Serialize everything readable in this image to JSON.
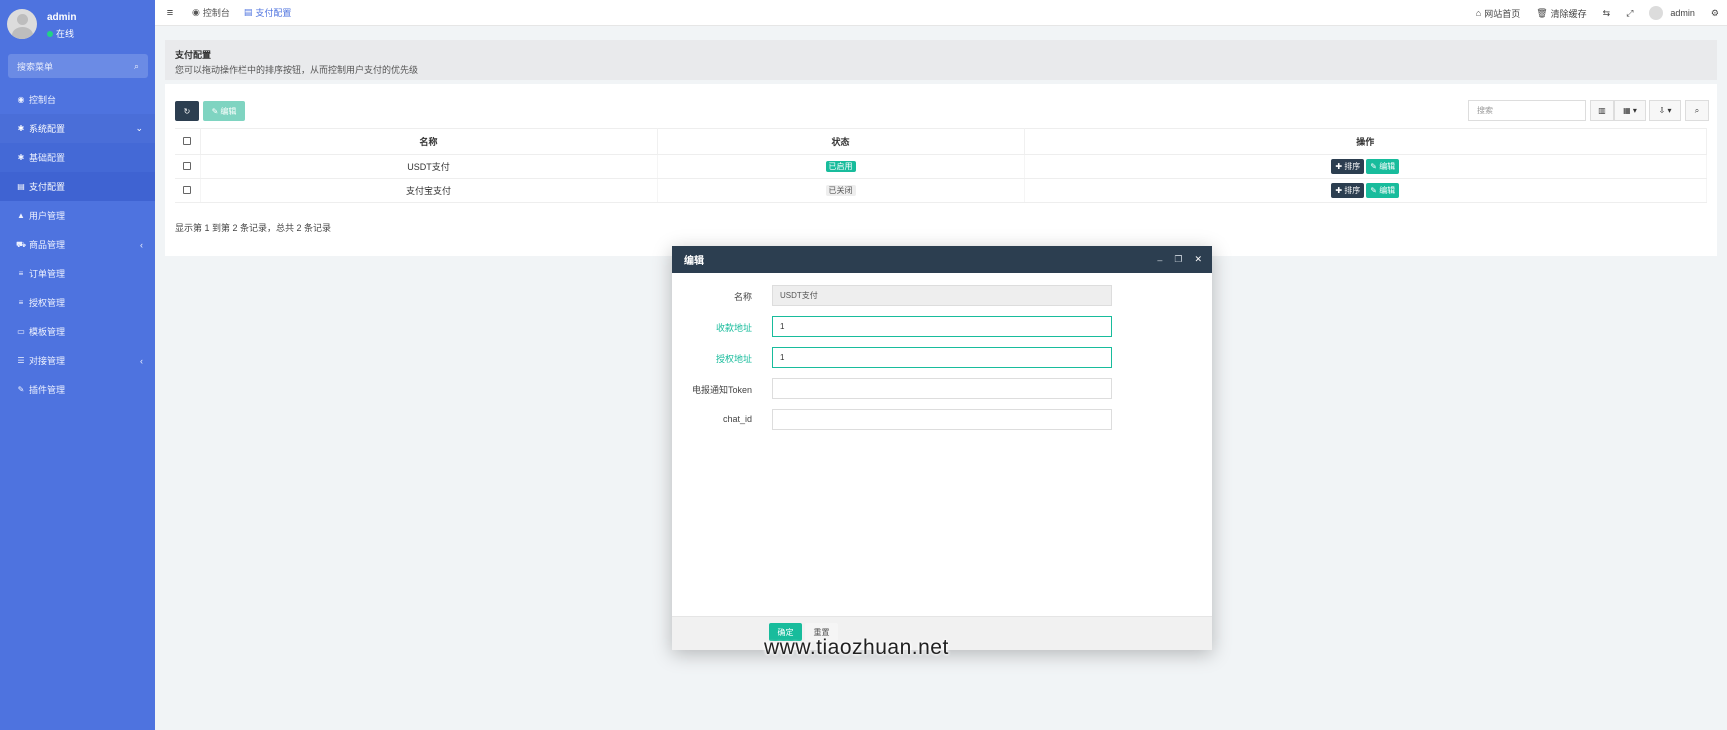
{
  "sidebar": {
    "user": {
      "name": "admin",
      "status": "在线"
    },
    "search_placeholder": "搜索菜单",
    "items": [
      {
        "label": "控制台",
        "icon": "dashboard-icon",
        "glyph": "◉"
      },
      {
        "label": "系统配置",
        "icon": "gear-icon",
        "glyph": "✱",
        "arrow": "⌄"
      },
      {
        "label": "基础配置",
        "icon": "gear-icon",
        "glyph": "✱"
      },
      {
        "label": "支付配置",
        "icon": "table-icon",
        "glyph": "▤"
      },
      {
        "label": "用户管理",
        "icon": "user-icon",
        "glyph": "▲"
      },
      {
        "label": "商品管理",
        "icon": "cart-icon",
        "glyph": "⛟",
        "arrow": "‹"
      },
      {
        "label": "订单管理",
        "icon": "list-icon",
        "glyph": "≡"
      },
      {
        "label": "授权管理",
        "icon": "list-icon",
        "glyph": "≡"
      },
      {
        "label": "模板管理",
        "icon": "template-icon",
        "glyph": "▭"
      },
      {
        "label": "对接管理",
        "icon": "sliders-icon",
        "glyph": "☰",
        "arrow": "‹"
      },
      {
        "label": "插件管理",
        "icon": "plug-icon",
        "glyph": "✎"
      }
    ]
  },
  "topbar": {
    "tabs": [
      {
        "label": "控制台",
        "icon": "dashboard-icon"
      },
      {
        "label": "支付配置",
        "icon": "table-icon"
      }
    ],
    "right": {
      "home": "网站首页",
      "clear_cache": "清除缓存",
      "user": "admin"
    }
  },
  "page": {
    "title": "支付配置",
    "description": "您可以拖动操作栏中的排序按钮，从而控制用户支付的优先级"
  },
  "toolbar": {
    "edit_label": "编辑",
    "search_placeholder": "搜索"
  },
  "table": {
    "headers": [
      "名称",
      "状态",
      "操作"
    ],
    "rows": [
      {
        "name": "USDT支付",
        "status": "已启用",
        "enabled": true
      },
      {
        "name": "支付宝支付",
        "status": "已关闭",
        "enabled": false
      }
    ],
    "action_sort": "排序",
    "action_edit": "编辑",
    "footer": "显示第 1 到第 2 条记录，总共 2 条记录"
  },
  "modal": {
    "title": "编辑",
    "fields": [
      {
        "label": "名称",
        "value": "USDT支付"
      },
      {
        "label": "收款地址",
        "value": "1"
      },
      {
        "label": "授权地址",
        "value": "1"
      },
      {
        "label": "电报通知Token",
        "value": ""
      },
      {
        "label": "chat_id",
        "value": ""
      }
    ],
    "ok_label": "确定",
    "reset_label": "重置"
  },
  "watermark": "www.tiaozhuan.net",
  "colors": {
    "sidebar": "#4e73df",
    "primary_dark": "#2c3e50",
    "success": "#18bc9c"
  }
}
